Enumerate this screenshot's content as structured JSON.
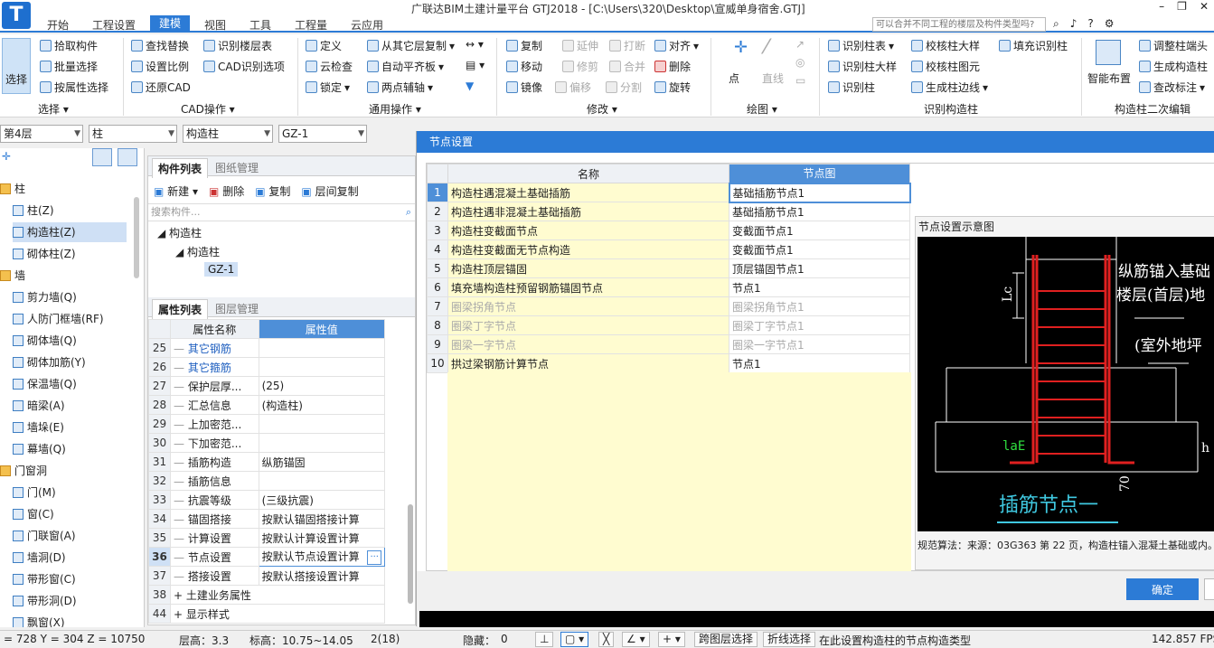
{
  "app": {
    "title": "广联达BIM土建计量平台 GTJ2018 - [C:\\Users\\320\\Desktop\\宣威单身宿舍.GTJ]",
    "help_search_placeholder": "可以合并不同工程的楼层及构件类型吗?",
    "logo_letter": "T"
  },
  "menu": [
    "开始",
    "工程设置",
    "建模",
    "视图",
    "工具",
    "工程量",
    "云应用"
  ],
  "menu_active": "建模",
  "ribbon": {
    "select_big": "选择",
    "select_items": [
      "拾取构件",
      "批量选择",
      "按属性选择"
    ],
    "cad_items": [
      "查找替换",
      "识别楼层表",
      "设置比例",
      "CAD识别选项",
      "还原CAD"
    ],
    "common_items": [
      "定义",
      "从其它层复制",
      "云检查",
      "自动平齐板",
      "锁定",
      "两点辅轴"
    ],
    "modify_items": [
      "复制",
      "延伸",
      "打断",
      "对齐",
      "移动",
      "修剪",
      "合并",
      "删除",
      "镜像",
      "偏移",
      "分割",
      "旋转"
    ],
    "draw_items": [
      "点",
      "直线"
    ],
    "identify_items": [
      "识别柱表",
      "校核柱大样",
      "填充识别柱",
      "识别柱大样",
      "校核柱图元",
      "识别柱",
      "生成柱边线"
    ],
    "secondary_items": [
      "智能布置",
      "调整柱端头",
      "生成构造柱",
      "查改标注"
    ],
    "groups": [
      "选择",
      "CAD操作",
      "通用操作",
      "修改",
      "绘图",
      "识别构造柱",
      "构造柱二次编辑"
    ]
  },
  "combos": [
    "第4层",
    "柱",
    "构造柱",
    "GZ-1"
  ],
  "left_tree": [
    {
      "label": "柱",
      "cat": true
    },
    {
      "label": "柱(Z)"
    },
    {
      "label": "构造柱(Z)",
      "sel": true
    },
    {
      "label": "砌体柱(Z)"
    },
    {
      "label": "墙",
      "cat": true
    },
    {
      "label": "剪力墙(Q)"
    },
    {
      "label": "人防门框墙(RF)"
    },
    {
      "label": "砌体墙(Q)"
    },
    {
      "label": "砌体加筋(Y)"
    },
    {
      "label": "保温墙(Q)"
    },
    {
      "label": "暗梁(A)"
    },
    {
      "label": "墙垛(E)"
    },
    {
      "label": "幕墙(Q)"
    },
    {
      "label": "门窗洞",
      "cat": true
    },
    {
      "label": "门(M)"
    },
    {
      "label": "窗(C)"
    },
    {
      "label": "门联窗(A)"
    },
    {
      "label": "墙洞(D)"
    },
    {
      "label": "带形窗(C)"
    },
    {
      "label": "带形洞(D)"
    },
    {
      "label": "飘窗(X)"
    }
  ],
  "component_panel": {
    "tabs": [
      "构件列表",
      "图纸管理"
    ],
    "tools": [
      "新建",
      "删除",
      "复制",
      "层间复制"
    ],
    "search_placeholder": "搜索构件...",
    "tree": [
      "构造柱",
      "构造柱",
      "GZ-1"
    ]
  },
  "property_panel": {
    "tabs": [
      "属性列表",
      "图层管理"
    ],
    "headers": [
      "属性名称",
      "属性值"
    ],
    "rows": [
      {
        "n": "25",
        "name": "其它钢筋",
        "value": "",
        "blue": true
      },
      {
        "n": "26",
        "name": "其它箍筋",
        "value": "",
        "blue": true
      },
      {
        "n": "27",
        "name": "保护层厚...",
        "value": "(25)"
      },
      {
        "n": "28",
        "name": "汇总信息",
        "value": "(构造柱)"
      },
      {
        "n": "29",
        "name": "上加密范...",
        "value": ""
      },
      {
        "n": "30",
        "name": "下加密范...",
        "value": ""
      },
      {
        "n": "31",
        "name": "插筋构造",
        "value": "纵筋锚固"
      },
      {
        "n": "32",
        "name": "插筋信息",
        "value": ""
      },
      {
        "n": "33",
        "name": "抗震等级",
        "value": "(三级抗震)"
      },
      {
        "n": "34",
        "name": "锚固搭接",
        "value": "按默认锚固搭接计算"
      },
      {
        "n": "35",
        "name": "计算设置",
        "value": "按默认计算设置计算"
      },
      {
        "n": "36",
        "name": "节点设置",
        "value": "按默认节点设置计算",
        "sel": true
      },
      {
        "n": "37",
        "name": "搭接设置",
        "value": "按默认搭接设置计算"
      },
      {
        "n": "38",
        "name": "土建业务属性",
        "value": "",
        "group": true
      },
      {
        "n": "44",
        "name": "显示样式",
        "value": "",
        "group": true
      }
    ]
  },
  "dialog": {
    "title": "节点设置",
    "headers": [
      "名称",
      "节点图"
    ],
    "rows": [
      {
        "n": "1",
        "name": "构造柱遇混凝土基础插筋",
        "node": "基础插筋节点1"
      },
      {
        "n": "2",
        "name": "构造柱遇非混凝土基础插筋",
        "node": "基础插筋节点1"
      },
      {
        "n": "3",
        "name": "构造柱变截面节点",
        "node": "变截面节点1"
      },
      {
        "n": "4",
        "name": "构造柱变截面无节点构造",
        "node": "变截面节点1"
      },
      {
        "n": "5",
        "name": "构造柱顶层锚固",
        "node": "顶层锚固节点1"
      },
      {
        "n": "6",
        "name": "填充墙构造柱预留钢筋锚固节点",
        "node": "节点1"
      },
      {
        "n": "7",
        "name": "圈梁拐角节点",
        "node": "圈梁拐角节点1",
        "gray": true
      },
      {
        "n": "8",
        "name": "圈梁丁字节点",
        "node": "圈梁丁字节点1",
        "gray": true
      },
      {
        "n": "9",
        "name": "圈梁一字节点",
        "node": "圈梁一字节点1",
        "gray": true
      },
      {
        "n": "10",
        "name": "拱过梁钢筋计算节点",
        "node": "节点1"
      }
    ],
    "schema_title": "节点设置示意图",
    "schema_labels": {
      "l1": "纵筋锚入基础",
      "l2": "楼层(首层)地",
      "l3": "(室外地坪",
      "lc": "Lc",
      "lae": "laE",
      "h": "h",
      "seventy": "70",
      "caption": "插筋节点一"
    },
    "description": "规范算法：来源：03G363 第 22 页，构造柱锚入混凝土基础或内。",
    "ok": "确定"
  },
  "status": {
    "coords": "= 728 Y = 304 Z = 10750",
    "layer_height": "层高：3.3",
    "elevation": "标高：10.75~14.05",
    "count": "2(18)",
    "hidden": "隐藏：",
    "hidden_val": "0",
    "cross_layer": "跨图层选择",
    "polyline": "折线选择",
    "hint": "在此设置构造柱的节点构造类型",
    "fps": "142.857 FPS"
  },
  "colors": {
    "accent": "#2c7bd6",
    "header_highlight": "#4e8fd8",
    "yellow_cell": "#fffcd0"
  }
}
